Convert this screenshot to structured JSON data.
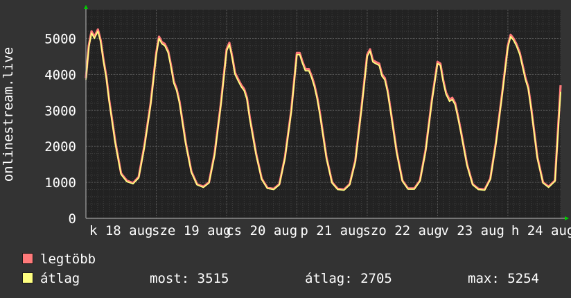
{
  "chart_data": {
    "type": "line",
    "ylabel": "onlinestream.live",
    "ylim": [
      0,
      5800
    ],
    "yticks": [
      0,
      1000,
      2000,
      3000,
      4000,
      5000
    ],
    "x_tick_labels": [
      "k 18 aug",
      "sze 19 aug",
      "cs 20 aug",
      "p 21 aug",
      "szo 22 aug",
      "v 23 aug",
      "h 24 aug"
    ],
    "x_day_start": 0,
    "x_day_end": 6.75,
    "grid": true,
    "colors": {
      "background": "#333333",
      "plot_background": "#222222",
      "grid_minor": "#3c3c3c",
      "grid_major": "#555555",
      "max_series": "#ff7a7a",
      "avg_series": "#ffff80",
      "axis_arrow": "#00cc00"
    },
    "series": [
      {
        "name": "legtöbb",
        "color": "#ff7a7a",
        "x": [
          0.0,
          0.04,
          0.08,
          0.12,
          0.17,
          0.21,
          0.25,
          0.29,
          0.33,
          0.42,
          0.5,
          0.58,
          0.67,
          0.75,
          0.83,
          0.92,
          1.0,
          1.04,
          1.08,
          1.12,
          1.17,
          1.21,
          1.25,
          1.29,
          1.33,
          1.42,
          1.5,
          1.58,
          1.67,
          1.75,
          1.83,
          1.92,
          2.0,
          2.04,
          2.08,
          2.12,
          2.17,
          2.21,
          2.25,
          2.29,
          2.33,
          2.42,
          2.5,
          2.58,
          2.67,
          2.75,
          2.83,
          2.92,
          3.0,
          3.04,
          3.08,
          3.12,
          3.17,
          3.21,
          3.25,
          3.29,
          3.33,
          3.42,
          3.5,
          3.58,
          3.67,
          3.75,
          3.83,
          3.92,
          4.0,
          4.04,
          4.08,
          4.12,
          4.17,
          4.21,
          4.25,
          4.29,
          4.33,
          4.42,
          4.5,
          4.58,
          4.67,
          4.75,
          4.83,
          4.92,
          5.0,
          5.04,
          5.08,
          5.12,
          5.17,
          5.21,
          5.25,
          5.29,
          5.33,
          5.42,
          5.5,
          5.58,
          5.67,
          5.75,
          5.83,
          5.92,
          6.0,
          6.04,
          6.08,
          6.12,
          6.17,
          6.21,
          6.25,
          6.29,
          6.33,
          6.42,
          6.5,
          6.58,
          6.67,
          6.75
        ],
        "values": [
          3900,
          4800,
          5200,
          5050,
          5250,
          4950,
          4400,
          3950,
          3300,
          2100,
          1250,
          1050,
          980,
          1150,
          2000,
          3200,
          4600,
          5050,
          4900,
          4850,
          4650,
          4250,
          3800,
          3600,
          3250,
          2100,
          1300,
          950,
          880,
          1000,
          1800,
          3200,
          4700,
          4880,
          4500,
          4050,
          3850,
          3700,
          3600,
          3350,
          2800,
          1800,
          1100,
          850,
          820,
          950,
          1700,
          3000,
          4600,
          4600,
          4350,
          4150,
          4150,
          3950,
          3700,
          3350,
          2900,
          1700,
          1000,
          820,
          800,
          950,
          1600,
          3100,
          4550,
          4700,
          4400,
          4350,
          4300,
          4000,
          3900,
          3550,
          3050,
          1850,
          1050,
          830,
          830,
          1050,
          1900,
          3300,
          4350,
          4300,
          3850,
          3500,
          3300,
          3350,
          3200,
          2850,
          2450,
          1500,
          950,
          820,
          800,
          1100,
          2100,
          3500,
          4800,
          5100,
          5000,
          4850,
          4600,
          4250,
          3900,
          3650,
          3100,
          1700,
          1000,
          880,
          1050,
          3700
        ]
      },
      {
        "name": "átlag",
        "color": "#ffff80",
        "x": [
          0.0,
          0.04,
          0.08,
          0.12,
          0.17,
          0.21,
          0.25,
          0.29,
          0.33,
          0.42,
          0.5,
          0.58,
          0.67,
          0.75,
          0.83,
          0.92,
          1.0,
          1.04,
          1.08,
          1.12,
          1.17,
          1.21,
          1.25,
          1.29,
          1.33,
          1.42,
          1.5,
          1.58,
          1.67,
          1.75,
          1.83,
          1.92,
          2.0,
          2.04,
          2.08,
          2.12,
          2.17,
          2.21,
          2.25,
          2.29,
          2.33,
          2.42,
          2.5,
          2.58,
          2.67,
          2.75,
          2.83,
          2.92,
          3.0,
          3.04,
          3.08,
          3.12,
          3.17,
          3.21,
          3.25,
          3.29,
          3.33,
          3.42,
          3.5,
          3.58,
          3.67,
          3.75,
          3.83,
          3.92,
          4.0,
          4.04,
          4.08,
          4.12,
          4.17,
          4.21,
          4.25,
          4.29,
          4.33,
          4.42,
          4.5,
          4.58,
          4.67,
          4.75,
          4.83,
          4.92,
          5.0,
          5.04,
          5.08,
          5.12,
          5.17,
          5.21,
          5.25,
          5.29,
          5.33,
          5.42,
          5.5,
          5.58,
          5.67,
          5.75,
          5.83,
          5.92,
          6.0,
          6.04,
          6.08,
          6.12,
          6.17,
          6.21,
          6.25,
          6.29,
          6.33,
          6.42,
          6.5,
          6.58,
          6.67,
          6.75
        ],
        "values": [
          3850,
          4750,
          5150,
          5000,
          5200,
          4900,
          4350,
          3900,
          3250,
          2050,
          1220,
          1020,
          960,
          1120,
          1950,
          3150,
          4550,
          5000,
          4850,
          4800,
          4600,
          4200,
          3750,
          3550,
          3200,
          2050,
          1270,
          930,
          860,
          980,
          1750,
          3150,
          4650,
          4830,
          4450,
          4000,
          3800,
          3650,
          3550,
          3300,
          2750,
          1760,
          1080,
          830,
          800,
          930,
          1660,
          2950,
          4550,
          4550,
          4300,
          4100,
          4100,
          3900,
          3650,
          3300,
          2850,
          1660,
          980,
          800,
          780,
          930,
          1560,
          3050,
          4500,
          4650,
          4350,
          4300,
          4250,
          3950,
          3850,
          3500,
          3000,
          1810,
          1030,
          810,
          810,
          1030,
          1860,
          3250,
          4300,
          4250,
          3800,
          3450,
          3250,
          3300,
          3150,
          2800,
          2400,
          1460,
          930,
          800,
          780,
          1080,
          2060,
          3450,
          4750,
          5050,
          4950,
          4800,
          4550,
          4200,
          3850,
          3600,
          3050,
          1660,
          980,
          860,
          1030,
          3515
        ]
      }
    ],
    "legend": {
      "max_label": "legtöbb",
      "avg_label": "átlag"
    },
    "stats": {
      "now": "most: 3515",
      "avg": "átlag: 2705",
      "max": "max: 5254"
    }
  }
}
